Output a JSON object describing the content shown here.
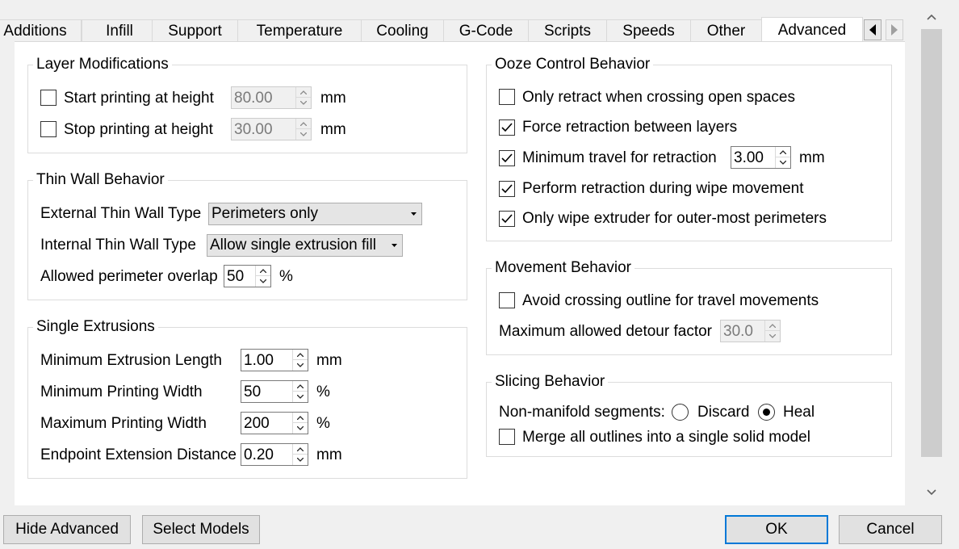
{
  "tabs": [
    {
      "label": "Additions"
    },
    {
      "label": "Infill"
    },
    {
      "label": "Support"
    },
    {
      "label": "Temperature"
    },
    {
      "label": "Cooling"
    },
    {
      "label": "G-Code"
    },
    {
      "label": "Scripts"
    },
    {
      "label": "Speeds"
    },
    {
      "label": "Other"
    },
    {
      "label": "Advanced",
      "active": true
    }
  ],
  "layer_mods": {
    "title": "Layer Modifications",
    "start": {
      "label": "Start printing at height",
      "checked": false,
      "value": "80.00",
      "unit": "mm"
    },
    "stop": {
      "label": "Stop printing at height",
      "checked": false,
      "value": "30.00",
      "unit": "mm"
    }
  },
  "thin_wall": {
    "title": "Thin Wall Behavior",
    "external": {
      "label": "External Thin Wall Type",
      "value": "Perimeters only"
    },
    "internal": {
      "label": "Internal Thin Wall Type",
      "value": "Allow single extrusion fill"
    },
    "overlap": {
      "label": "Allowed perimeter overlap",
      "value": "50",
      "unit": "%"
    }
  },
  "single_ext": {
    "title": "Single Extrusions",
    "rows": [
      {
        "label": "Minimum Extrusion Length",
        "value": "1.00",
        "unit": "mm"
      },
      {
        "label": "Minimum Printing Width",
        "value": "50",
        "unit": "%"
      },
      {
        "label": "Maximum Printing Width",
        "value": "200",
        "unit": "%"
      },
      {
        "label": "Endpoint Extension Distance",
        "value": "0.20",
        "unit": "mm"
      }
    ]
  },
  "ooze": {
    "title": "Ooze Control Behavior",
    "retract_open": {
      "label": "Only retract when crossing open spaces",
      "checked": false
    },
    "force_retract": {
      "label": "Force retraction between layers",
      "checked": true
    },
    "min_travel": {
      "label": "Minimum travel for retraction",
      "checked": true,
      "value": "3.00",
      "unit": "mm"
    },
    "wipe_retract": {
      "label": "Perform retraction during wipe movement",
      "checked": true
    },
    "wipe_outer": {
      "label": "Only wipe extruder for outer-most perimeters",
      "checked": true
    }
  },
  "movement": {
    "title": "Movement Behavior",
    "avoid": {
      "label": "Avoid crossing outline for travel movements",
      "checked": false
    },
    "detour": {
      "label": "Maximum allowed detour factor",
      "value": "30.0"
    }
  },
  "slicing": {
    "title": "Slicing Behavior",
    "nonmanifold_label": "Non-manifold segments:",
    "discard_label": "Discard",
    "heal_label": "Heal",
    "selected": "Heal",
    "merge": {
      "label": "Merge all outlines into a single solid model",
      "checked": false
    }
  },
  "footer": {
    "hide_advanced": "Hide Advanced",
    "select_models": "Select Models",
    "ok": "OK",
    "cancel": "Cancel"
  }
}
